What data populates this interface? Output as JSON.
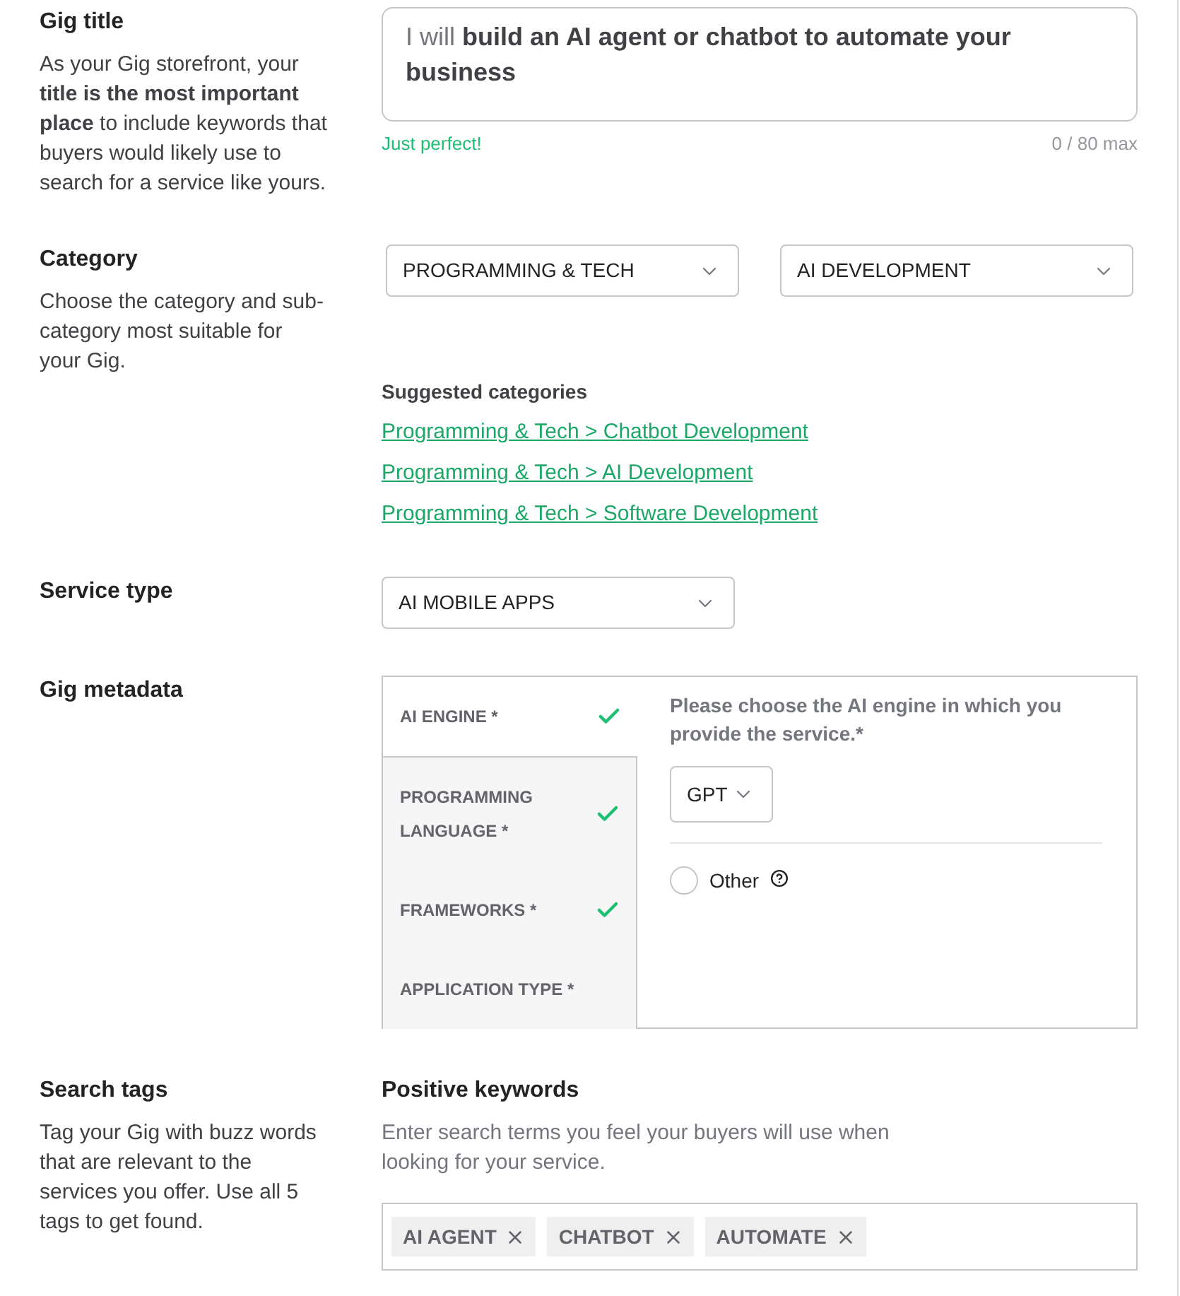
{
  "gig_title": {
    "heading": "Gig title",
    "description": "As your Gig storefront, your **title is the most important place** to include keywords that buyers would likely use to search for a service like yours.",
    "prefix": "I will",
    "value": "build an AI agent or chatbot to automate your business",
    "status": "Just perfect!",
    "counter": "0 / 80 max"
  },
  "category": {
    "heading": "Category",
    "description": "Choose the category and sub-category most suitable for your Gig.",
    "selects": [
      {
        "value": "PROGRAMMING & TECH"
      },
      {
        "value": "AI DEVELOPMENT"
      }
    ],
    "suggested_heading": "Suggested categories",
    "suggestions": [
      "Programming & Tech > Chatbot Development",
      "Programming & Tech > AI Development",
      "Programming & Tech > Software Development"
    ]
  },
  "service_type": {
    "heading": "Service type",
    "value": "AI MOBILE APPS"
  },
  "metadata": {
    "heading": "Gig metadata",
    "tabs": [
      {
        "label": "AI ENGINE *",
        "selected": true,
        "completed": true
      },
      {
        "label": "PROGRAMMING LANGUAGE *",
        "selected": false,
        "completed": true
      },
      {
        "label": "FRAMEWORKS *",
        "selected": false,
        "completed": true
      },
      {
        "label": "APPLICATION TYPE *",
        "selected": false,
        "completed": false
      }
    ],
    "question": "Please choose the AI engine in which you provide the service.*",
    "select_value": "GPT",
    "options": [
      {
        "label": "Other",
        "checked": false
      }
    ]
  },
  "search_tags": {
    "heading": "Search tags",
    "description": "Tag your Gig with buzz words that are relevant to the services you offer. Use all 5 tags to get found.",
    "keywords_heading": "Positive keywords",
    "keywords_description": "Enter search terms you feel your buyers will use when looking for your service.",
    "tags": [
      "AI AGENT",
      "CHATBOT",
      "AUTOMATE"
    ]
  }
}
